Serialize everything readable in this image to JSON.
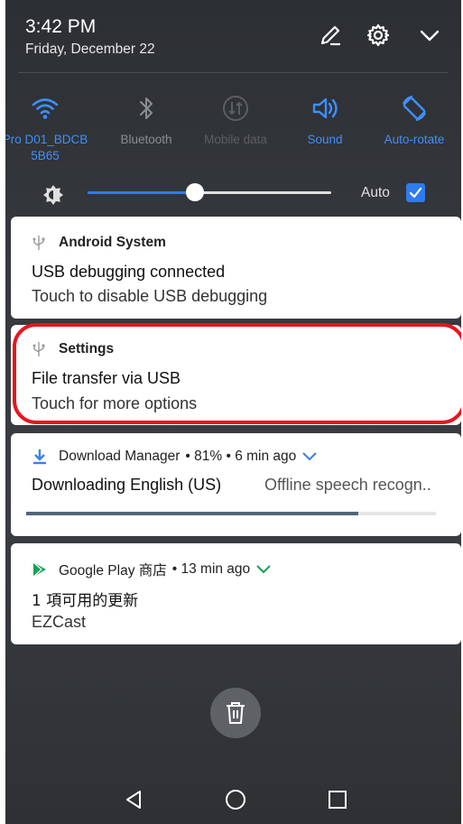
{
  "status": {
    "time": "3:42 PM",
    "date": "Friday, December 22"
  },
  "quick_settings": [
    {
      "label": "Pro D01_BDCB 5B65",
      "icon": "wifi-icon",
      "state": "on"
    },
    {
      "label": "Bluetooth",
      "icon": "bluetooth-icon",
      "state": "off"
    },
    {
      "label": "Mobile data",
      "icon": "mobile-data-icon",
      "state": "disabled"
    },
    {
      "label": "Sound",
      "icon": "sound-icon",
      "state": "on"
    },
    {
      "label": "Auto-rotate",
      "icon": "auto-rotate-icon",
      "state": "on"
    }
  ],
  "brightness": {
    "level": 0.44,
    "auto_label": "Auto",
    "auto_checked": true
  },
  "notifications": [
    {
      "app": "Android System",
      "title": "USB debugging connected",
      "text": "Touch to disable USB debugging"
    },
    {
      "app": "Settings",
      "title": "File transfer via USB",
      "text": "Touch for more options"
    },
    {
      "app": "Download Manager",
      "meta": "• 81% • 6 min ago",
      "title": "Downloading English (US)",
      "text": "Offline speech recogn..",
      "progress": 0.81
    },
    {
      "app": "Google Play 商店",
      "meta": "• 13 min ago",
      "title": "1 項可用的更新",
      "text": "EZCast"
    }
  ],
  "colors": {
    "accent": "#2f7bf0",
    "highlight": "#e8141f",
    "play_green": "#1a9e55"
  }
}
